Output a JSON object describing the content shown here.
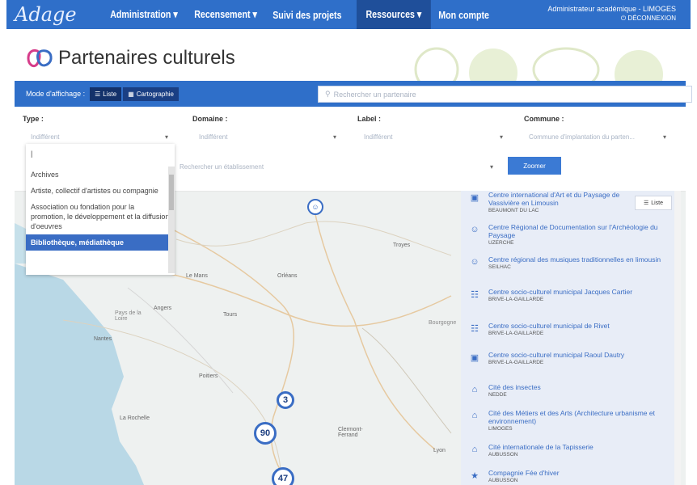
{
  "nav": {
    "logo": "Adage",
    "items": [
      {
        "label": "Administration ▾"
      },
      {
        "label": "Recensement ▾"
      },
      {
        "label": "Suivi des projets"
      },
      {
        "label": "Ressources ▾"
      },
      {
        "label": "Mon compte"
      }
    ],
    "active_index": 3,
    "user_role": "Administrateur académique - LIMOGES",
    "logout": "⏻ DÉCONNEXION"
  },
  "page": {
    "title": "Partenaires culturels"
  },
  "mode": {
    "label": "Mode d'affichage :",
    "liste": "Liste",
    "cartographie": "Cartographie",
    "search_placeholder": "Rechercher un partenaire"
  },
  "filters": [
    {
      "label": "Type :",
      "value": "Indifférent"
    },
    {
      "label": "Domaine :",
      "value": "Indifférent"
    },
    {
      "label": "Label :",
      "value": "Indifférent"
    },
    {
      "label": "Commune :",
      "value": "Commune d'implantation du parten..."
    }
  ],
  "etab": {
    "placeholder": "Rechercher un établissement",
    "zoom_label": "Zoomer"
  },
  "type_options": [
    {
      "label": "|"
    },
    {
      "label": "Archives"
    },
    {
      "label": "Artiste, collectif d'artistes ou compagnie"
    },
    {
      "label": "Association ou fondation pour la promotion, le développement et la diffusion d'oeuvres"
    },
    {
      "label": "Bibliothèque, médiathèque"
    }
  ],
  "type_selected_index": 4,
  "map": {
    "clusters": [
      {
        "label": "3"
      },
      {
        "label": "90"
      },
      {
        "label": "47"
      }
    ],
    "places": [
      "Nantes",
      "La Rochelle",
      "Poitiers",
      "Tours",
      "Angers",
      "Le Mans",
      "Orléans",
      "Troyes",
      "Lyon",
      "Clermont-Ferrand",
      "Pays de la Loire",
      "Bourgogne"
    ]
  },
  "list": {
    "liste_button": "Liste",
    "items": [
      {
        "name": "Centre international d'Art et du Paysage de Vassivière en Limousin",
        "city": "BEAUMONT DU LAC",
        "icon": "monitor-icon"
      },
      {
        "name": "Centre Régional de Documentation sur l'Archéologie du Paysage",
        "city": "UZERCHE",
        "icon": "people-icon"
      },
      {
        "name": "Centre régional des musiques traditionnelles en limousin",
        "city": "SEILHAC",
        "icon": "people-icon"
      },
      {
        "name": "Centre socio-culturel municipal Jacques Cartier",
        "city": "BRIVE-LA-GAILLARDE",
        "icon": "columns-icon"
      },
      {
        "name": "Centre socio-culturel municipal de Rivet",
        "city": "BRIVE-LA-GAILLARDE",
        "icon": "columns-icon"
      },
      {
        "name": "Centre socio-culturel municipal Raoul Dautry",
        "city": "BRIVE-LA-GAILLARDE",
        "icon": "monitor-icon"
      },
      {
        "name": "Cité des insectes",
        "city": "NEDDE",
        "icon": "museum-icon"
      },
      {
        "name": "Cité des Métiers et des Arts (Architecture urbanisme et environnement)",
        "city": "LIMOGES",
        "icon": "museum-icon"
      },
      {
        "name": "Cité internationale de la Tapisserie",
        "city": "AUBUSSON",
        "icon": "museum-icon"
      },
      {
        "name": "Compagnie Fée d'hiver",
        "city": "AUBUSSON",
        "icon": "star-icon"
      }
    ]
  },
  "colors": {
    "primary": "#2f6fc9",
    "dark": "#1f4f9a",
    "link": "#3a6dc4",
    "panel": "#e8edf7"
  }
}
